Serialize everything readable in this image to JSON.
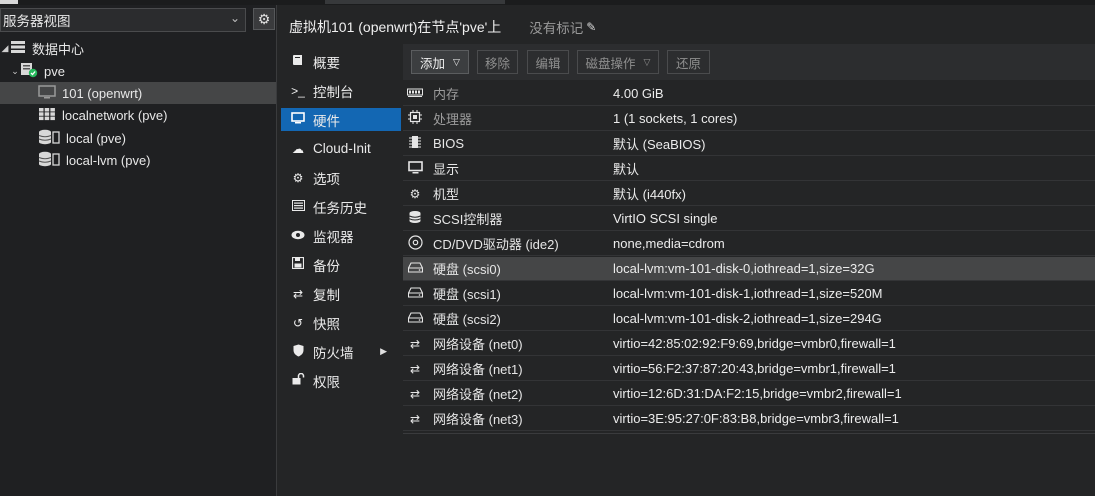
{
  "tree": {
    "view_label": "服务器视图",
    "items": [
      {
        "label": "数据中心",
        "icon": "datacenter-icon"
      },
      {
        "label": "pve",
        "icon": "node-online-icon"
      },
      {
        "label": "101 (openwrt)",
        "icon": "vm-icon"
      },
      {
        "label": "localnetwork (pve)",
        "icon": "network-grid-icon"
      },
      {
        "label": "local (pve)",
        "icon": "storage-icon"
      },
      {
        "label": "local-lvm (pve)",
        "icon": "storage-icon"
      }
    ]
  },
  "header": {
    "title": "虚拟机101 (openwrt)在节点'pve'上",
    "tags": "没有标记"
  },
  "nav": {
    "items": [
      {
        "label": "概要",
        "icon": "book-icon"
      },
      {
        "label": "控制台",
        "icon": "terminal-icon"
      },
      {
        "label": "硬件",
        "icon": "monitor-icon"
      },
      {
        "label": "Cloud-Init",
        "icon": "cloud-icon"
      },
      {
        "label": "选项",
        "icon": "gear-icon"
      },
      {
        "label": "任务历史",
        "icon": "list-icon"
      },
      {
        "label": "监视器",
        "icon": "eye-icon"
      },
      {
        "label": "备份",
        "icon": "floppy-icon"
      },
      {
        "label": "复制",
        "icon": "retweet-icon"
      },
      {
        "label": "快照",
        "icon": "history-icon"
      },
      {
        "label": "防火墙",
        "icon": "shield-icon"
      },
      {
        "label": "权限",
        "icon": "unlock-icon"
      }
    ]
  },
  "toolbar": {
    "add": "添加",
    "remove": "移除",
    "edit": "编辑",
    "disk_action": "磁盘操作",
    "revert": "还原"
  },
  "hardware": {
    "rows": [
      {
        "name": "内存",
        "value": "4.00 GiB",
        "icon": "memory-icon"
      },
      {
        "name": "处理器",
        "value": "1 (1 sockets, 1 cores)",
        "icon": "cpu-icon"
      },
      {
        "name": "BIOS",
        "value": "默认 (SeaBIOS)",
        "icon": "chip-icon"
      },
      {
        "name": "显示",
        "value": "默认",
        "icon": "display-icon"
      },
      {
        "name": "机型",
        "value": "默认 (i440fx)",
        "icon": "cogs-icon"
      },
      {
        "name": "SCSI控制器",
        "value": "VirtIO SCSI single",
        "icon": "database-icon"
      },
      {
        "name": "CD/DVD驱动器 (ide2)",
        "value": "none,media=cdrom",
        "icon": "cdrom-icon"
      },
      {
        "name": "硬盘 (scsi0)",
        "value": "local-lvm:vm-101-disk-0,iothread=1,size=32G",
        "icon": "hdd-icon"
      },
      {
        "name": "硬盘 (scsi1)",
        "value": "local-lvm:vm-101-disk-1,iothread=1,size=520M",
        "icon": "hdd-icon"
      },
      {
        "name": "硬盘 (scsi2)",
        "value": "local-lvm:vm-101-disk-2,iothread=1,size=294G",
        "icon": "hdd-icon"
      },
      {
        "name": "网络设备 (net0)",
        "value": "virtio=42:85:02:92:F9:69,bridge=vmbr0,firewall=1",
        "icon": "exchange-icon"
      },
      {
        "name": "网络设备 (net1)",
        "value": "virtio=56:F2:37:87:20:43,bridge=vmbr1,firewall=1",
        "icon": "exchange-icon"
      },
      {
        "name": "网络设备 (net2)",
        "value": "virtio=12:6D:31:DA:F2:15,bridge=vmbr2,firewall=1",
        "icon": "exchange-icon"
      },
      {
        "name": "网络设备 (net3)",
        "value": "virtio=3E:95:27:0F:83:B8,bridge=vmbr3,firewall=1",
        "icon": "exchange-icon"
      }
    ]
  }
}
